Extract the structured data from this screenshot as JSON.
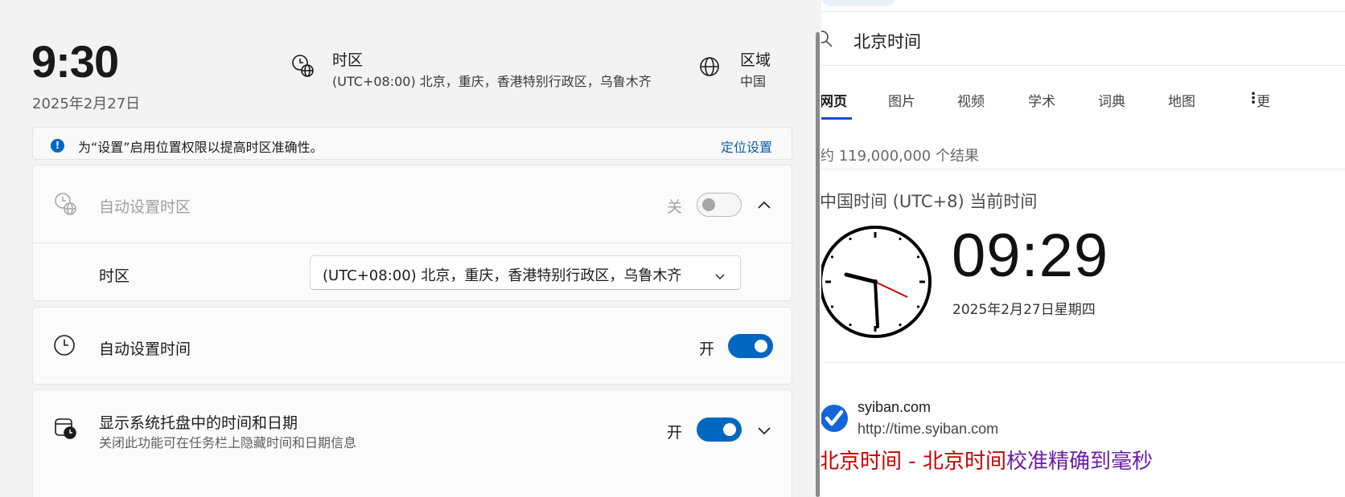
{
  "settings": {
    "clock": {
      "time": "9:30",
      "date": "2025年2月27日"
    },
    "header_timezone": {
      "title": "时区",
      "value": "(UTC+08:00) 北京，重庆，香港特别行政区，乌鲁木齐"
    },
    "header_region": {
      "title": "区域",
      "value": "中国"
    },
    "info_bar": {
      "icon": "!",
      "text": "为“设置”启用位置权限以提高时区准确性。",
      "link": "定位设置"
    },
    "auto_timezone": {
      "label": "自动设置时区",
      "state_label": "关",
      "on": false
    },
    "timezone_row": {
      "label": "时区",
      "selected": "(UTC+08:00) 北京，重庆，香港特别行政区，乌鲁木齐"
    },
    "auto_time": {
      "label": "自动设置时间",
      "state_label": "开",
      "on": true
    },
    "tray_clock": {
      "label": "显示系统托盘中的时间和日期",
      "sublabel": "关闭此功能可在任务栏上隐藏时间和日期信息",
      "state_label": "开",
      "on": true
    },
    "accent_color": "#0067c0"
  },
  "browser": {
    "search_query": "北京时间",
    "tabs": [
      {
        "label": "网页",
        "active": true
      },
      {
        "label": "图片",
        "active": false
      },
      {
        "label": "视频",
        "active": false
      },
      {
        "label": "学术",
        "active": false
      },
      {
        "label": "词典",
        "active": false
      },
      {
        "label": "地图",
        "active": false
      },
      {
        "label": "更",
        "active": false
      }
    ],
    "result_count": "约 119,000,000 个结果",
    "clock_card": {
      "title": "中国时间 (UTC+8) 当前时间",
      "digital_time": "09:29",
      "date": "2025年2月27日星期四"
    },
    "result": {
      "site_name": "syiban.com",
      "site_url": "http://time.syiban.com",
      "title_highlight_1": "北京时间",
      "title_sep": " - ",
      "title_highlight_2": "北京时间",
      "title_rest": "校准精确到毫秒"
    },
    "link_color": "#681da8",
    "highlight_color": "#c80000"
  }
}
